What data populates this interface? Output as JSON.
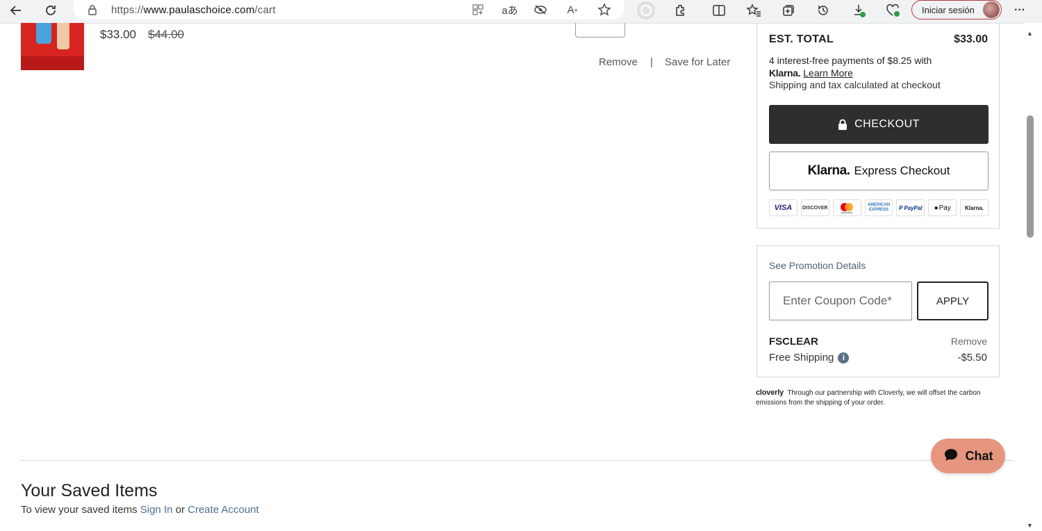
{
  "browser": {
    "url_prefix": "https://",
    "url_domain": "www.paulaschoice.com",
    "url_path": "/cart",
    "sign_in_label": "Iniciar sesión",
    "more_label": "···"
  },
  "cart_item": {
    "price": "$33.00",
    "original_price": "$44.00",
    "remove_label": "Remove",
    "separator": "|",
    "save_later_label": "Save for Later"
  },
  "summary": {
    "est_total_label": "EST. TOTAL",
    "est_total_value": "$33.00",
    "klarna_text": "4 interest-free payments of $8.25 with",
    "klarna_word": "Klarna.",
    "learn_more": "Learn More",
    "shipping_note": "Shipping and tax calculated at checkout",
    "checkout_label": "CHECKOUT",
    "klarna_brand": "Klarna.",
    "express_label": "Express Checkout",
    "payment_cards": [
      "VISA",
      "DISCOVER",
      "mastercard",
      "AMERICAN EXPRESS",
      "PayPal",
      "Pay",
      "Klarna."
    ]
  },
  "promo": {
    "title": "See Promotion Details",
    "coupon_placeholder": "Enter Coupon Code*",
    "apply_label": "APPLY",
    "code": "FSCLEAR",
    "remove_label": "Remove",
    "free_shipping_label": "Free Shipping",
    "discount": "-$5.50"
  },
  "cloverly": {
    "brand": "cloverly",
    "text": "Through our partnership with Cloverly, we will offset the carbon emissions from the shipping of your order."
  },
  "saved": {
    "title": "Your Saved Items",
    "prefix": "To view your saved items",
    "sign_in": "Sign In",
    "or": "or",
    "create_account": "Create Account"
  },
  "chat": {
    "label": "Chat"
  }
}
